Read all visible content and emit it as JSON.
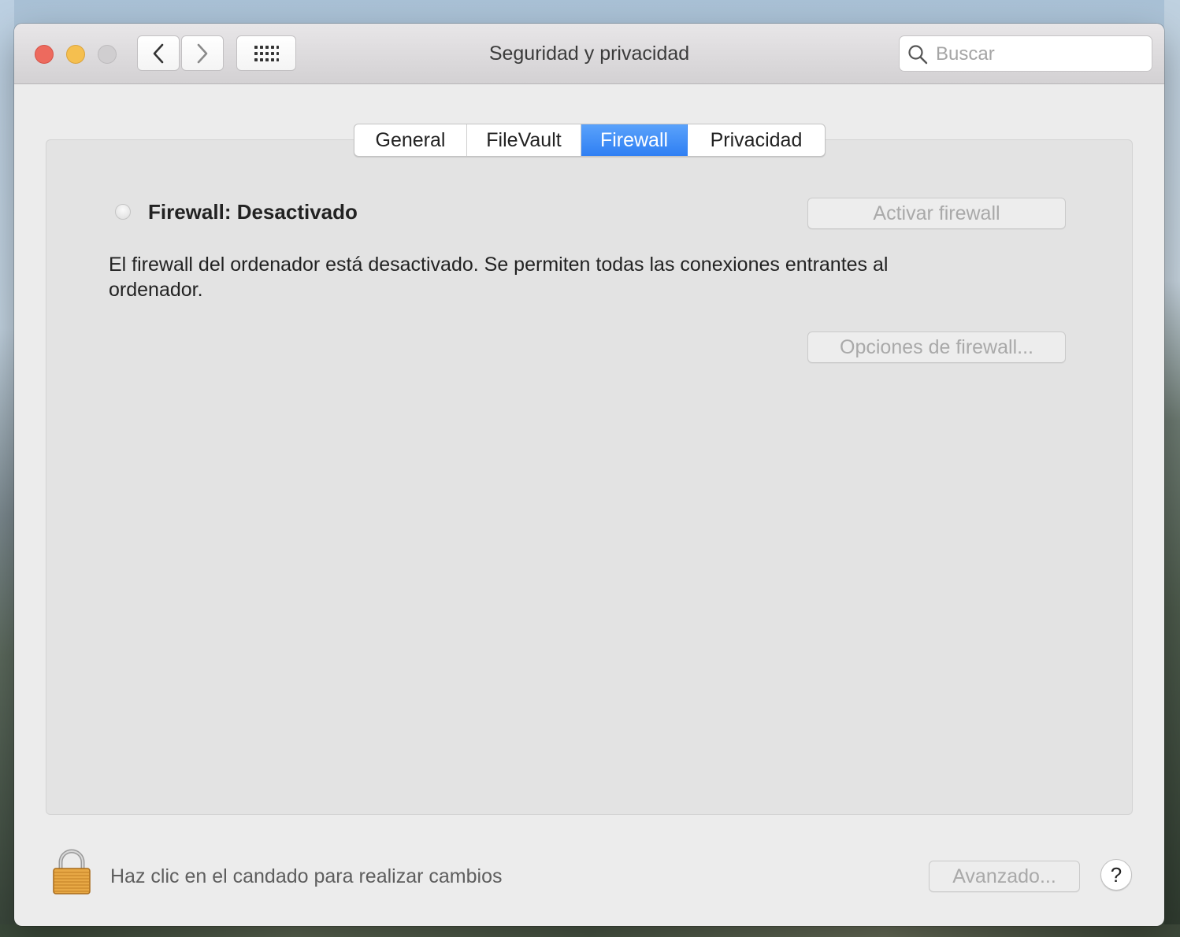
{
  "window": {
    "title": "Seguridad y privacidad"
  },
  "search": {
    "placeholder": "Buscar"
  },
  "tabs": [
    {
      "label": "General",
      "active": false
    },
    {
      "label": "FileVault",
      "active": false
    },
    {
      "label": "Firewall",
      "active": true
    },
    {
      "label": "Privacidad",
      "active": false
    }
  ],
  "firewall": {
    "status_label": "Firewall: Desactivado",
    "activate_button": "Activar firewall",
    "description": "El firewall del ordenador está desactivado. Se permiten todas las conexiones entrantes al ordenador.",
    "options_button": "Opciones de firewall..."
  },
  "footer": {
    "lock_text": "Haz clic en el candado para realizar cambios",
    "advanced_button": "Avanzado...",
    "help_label": "?"
  },
  "colors": {
    "accent": "#2f7ff3",
    "close": "#ed6a5e",
    "minimize": "#f5bf4f"
  }
}
